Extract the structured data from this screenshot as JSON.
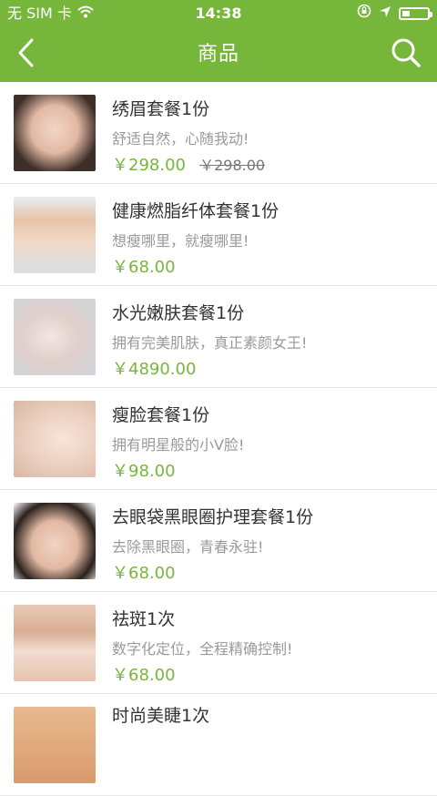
{
  "status": {
    "carrier": "无 SIM 卡",
    "time": "14:38"
  },
  "header": {
    "title": "商品"
  },
  "products": [
    {
      "title": "绣眉套餐1份",
      "subtitle": "舒适自然，心随我动!",
      "price": "￥298.00",
      "original_price": "￥298.00"
    },
    {
      "title": "健康燃脂纤体套餐1份",
      "subtitle": "想瘦哪里，就瘦哪里!",
      "price": "￥68.00"
    },
    {
      "title": "水光嫩肤套餐1份",
      "subtitle": "拥有完美肌肤，真正素颜女王!",
      "price": "￥4890.00"
    },
    {
      "title": "瘦脸套餐1份",
      "subtitle": "拥有明星般的小V脸!",
      "price": "￥98.00"
    },
    {
      "title": "去眼袋黑眼圈护理套餐1份",
      "subtitle": "去除黑眼圈，青春永驻!",
      "price": "￥68.00"
    },
    {
      "title": "祛斑1次",
      "subtitle": "数字化定位，全程精确控制!",
      "price": "￥68.00"
    },
    {
      "title": "时尚美睫1次"
    }
  ],
  "colors": {
    "accent": "#76b73b"
  },
  "icons": [
    "back-icon",
    "search-icon",
    "wifi-icon",
    "location-icon",
    "battery-icon"
  ]
}
